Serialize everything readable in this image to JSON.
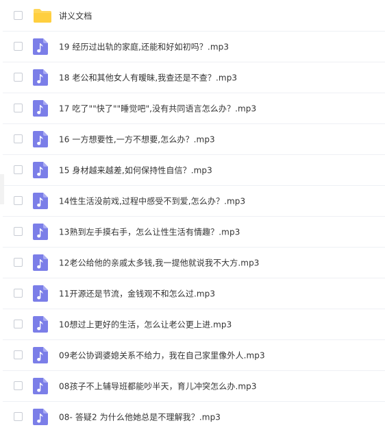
{
  "colors": {
    "folder": "#ffd659",
    "audio_file": "#7b7ee8",
    "text": "#333333",
    "divider": "#eef0f4"
  },
  "files": [
    {
      "name": "讲义文档",
      "icon": "folder-icon"
    },
    {
      "name": "19 经历过出轨的家庭,还能和好如初吗？.mp3",
      "icon": "audio-file-icon"
    },
    {
      "name": "18 老公和其他女人有暧昧,我查还是不查？.mp3",
      "icon": "audio-file-icon"
    },
    {
      "name": "17 吃了\"\"快了\"\"睡觉吧\",没有共同语言怎么办？.mp3",
      "icon": "audio-file-icon"
    },
    {
      "name": "16 一方想要性,一方不想要,怎么办？.mp3",
      "icon": "audio-file-icon"
    },
    {
      "name": "15 身材越来越差,如何保持性自信？.mp3",
      "icon": "audio-file-icon"
    },
    {
      "name": "14性生活没前戏,过程中感受不到爱,怎么办？.mp3",
      "icon": "audio-file-icon"
    },
    {
      "name": "13熟到左手摸右手，怎么让性生活有情趣？.mp3",
      "icon": "audio-file-icon"
    },
    {
      "name": "12老公给他的亲戚太多钱,我一提他就说我不大方.mp3",
      "icon": "audio-file-icon"
    },
    {
      "name": "11开源还是节流，金钱观不和怎么过.mp3",
      "icon": "audio-file-icon"
    },
    {
      "name": "10想过上更好的生活，怎么让老公更上进.mp3",
      "icon": "audio-file-icon"
    },
    {
      "name": "09老公协调婆媳关系不给力，我在自己家里像外人.mp3",
      "icon": "audio-file-icon"
    },
    {
      "name": "08孩子不上辅导班都能吵半天，育儿冲突怎么办.mp3",
      "icon": "audio-file-icon"
    },
    {
      "name": "08- 答疑2 为什么他她总是不理解我？.mp3",
      "icon": "audio-file-icon"
    }
  ]
}
